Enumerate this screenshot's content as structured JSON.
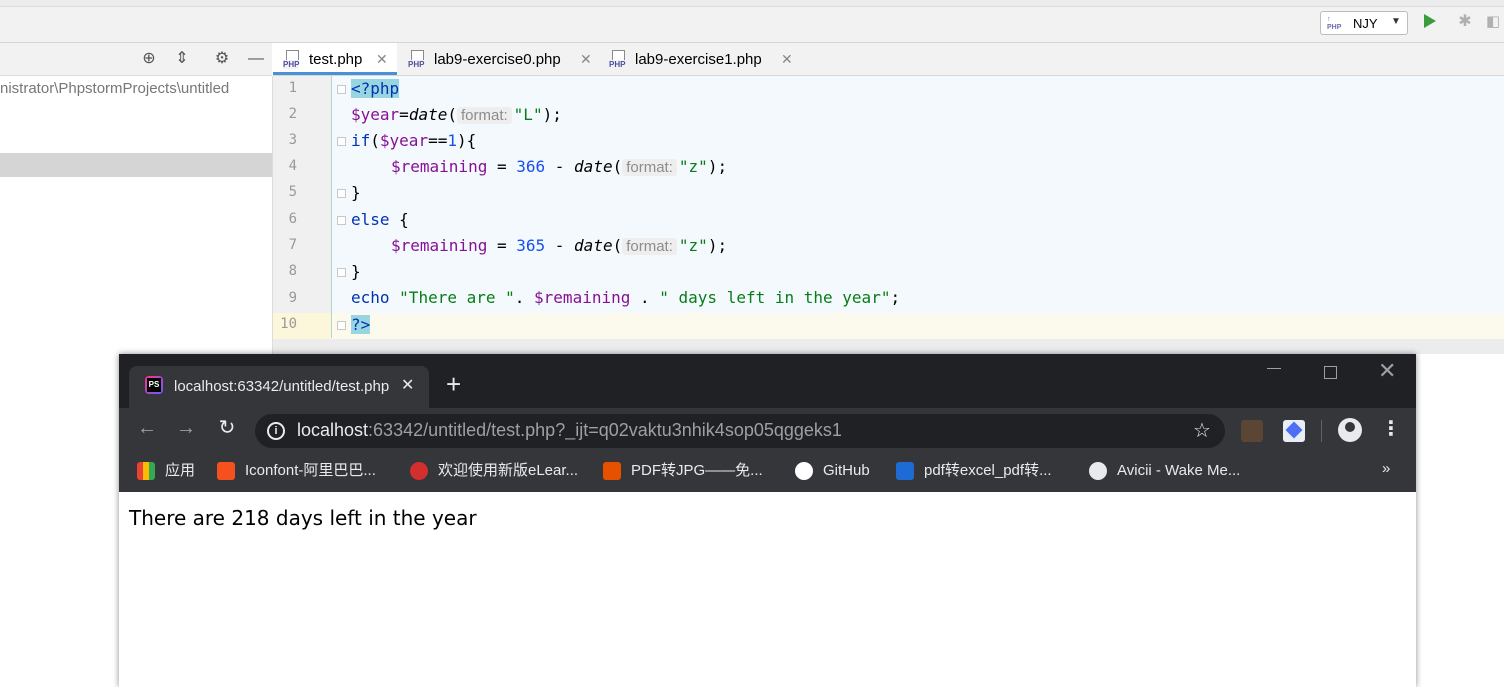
{
  "ide": {
    "run_config": {
      "label": "NJY",
      "icon": "php-run-config-icon"
    },
    "project": {
      "path": "nistrator\\PhpstormProjects\\untitled"
    },
    "tabs": [
      {
        "label": "test.php",
        "active": true
      },
      {
        "label": "lab9-exercise0.php",
        "active": false
      },
      {
        "label": "lab9-exercise1.php",
        "active": false
      }
    ],
    "line_numbers": [
      "1",
      "2",
      "3",
      "4",
      "5",
      "6",
      "7",
      "8",
      "9",
      "10"
    ],
    "hint_label": "format:",
    "code": {
      "l1": "<?php",
      "l2_var": "$year",
      "l2_eq": "=",
      "l2_fn": "date",
      "l2_paren": "(",
      "l2_str": "\"L\"",
      "l2_end": ");",
      "l3_kw": "if",
      "l3_a": "(",
      "l3_var": "$year",
      "l3_op": "==",
      "l3_num": "1",
      "l3_end": "){",
      "l4_var": "$remaining",
      "l4_op": " = ",
      "l4_num": "366",
      "l4_minus": " - ",
      "l4_fn": "date",
      "l4_paren": "(",
      "l4_str": "\"z\"",
      "l4_end": ");",
      "l5": "}",
      "l6_kw": "else",
      "l6_end": " {",
      "l7_var": "$remaining",
      "l7_op": " = ",
      "l7_num": "365",
      "l7_minus": " - ",
      "l7_fn": "date",
      "l7_paren": "(",
      "l7_str": "\"z\"",
      "l7_end": ");",
      "l8": "}",
      "l9_kw": "echo",
      "l9_str1": "\"There are \"",
      "l9_dot1": ". ",
      "l9_var": "$remaining",
      "l9_dot2": " . ",
      "l9_str2": "\" days left in the year\"",
      "l9_end": ";",
      "l10": "?>"
    }
  },
  "browser": {
    "tab_title": "localhost:63342/untitled/test.php",
    "url_host": "localhost",
    "url_rest": ":63342/untitled/test.php?_ijt=q02vaktu3nhik4sop05qggeks1",
    "bookmarks": [
      {
        "label": "应用",
        "icon": "apps-grid-icon",
        "color": "#e94235"
      },
      {
        "label": "Iconfont-阿里巴巴...",
        "icon": "iconfont-icon",
        "color": "#f4511e"
      },
      {
        "label": "欢迎使用新版eLear...",
        "icon": "elearning-icon",
        "color": "#d32f2f"
      },
      {
        "label": "PDF转JPG——免...",
        "icon": "pdf-icon",
        "color": "#e65100"
      },
      {
        "label": "GitHub",
        "icon": "github-icon",
        "color": "#ffffff"
      },
      {
        "label": "pdf转excel_pdf转...",
        "icon": "z-icon",
        "color": "#1e6bd6"
      },
      {
        "label": "Avicii - Wake Me...",
        "icon": "globe-icon",
        "color": "#e8eaed"
      }
    ],
    "more_bookmarks": "»",
    "page_text": "There are 218 days left in the year"
  }
}
